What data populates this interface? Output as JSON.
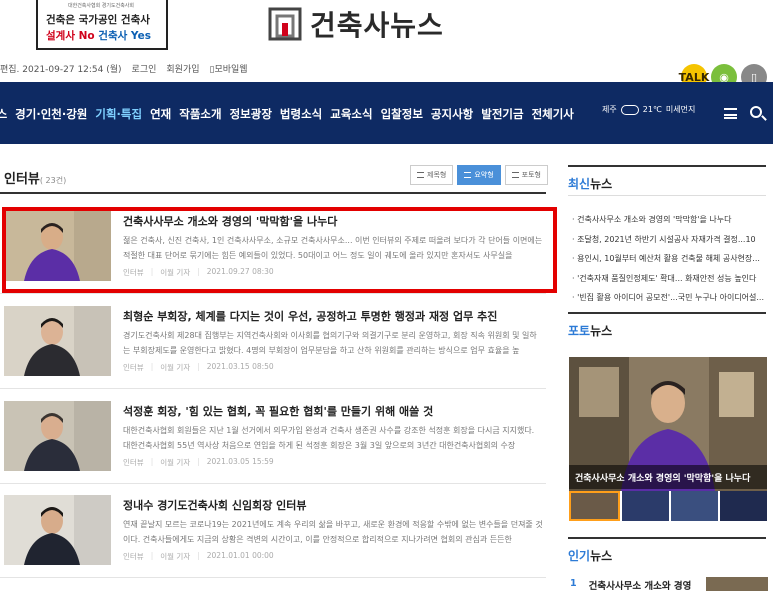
{
  "banner": {
    "small": "대한건축사협회 경기도건축사회",
    "line1": "건축은 국가공인 건축사",
    "line2_red": "설계사 No ",
    "line2_blue": "건축사 Yes"
  },
  "logo": {
    "text": "건축사뉴스"
  },
  "util": {
    "edited": "편집. 2021-09-27 12:54 (월)",
    "login": "로그인",
    "join": "회원가입",
    "mobile": "모바일웹"
  },
  "sns": [
    "카카오톡",
    "RSS",
    "설정"
  ],
  "nav": {
    "items": [
      "뉴스",
      "경기·인천·강원",
      "기획·특집",
      "연재",
      "작품소개",
      "정보광장",
      "법령소식",
      "교육소식",
      "입찰정보",
      "공지사항",
      "발전기금",
      "전체기사"
    ],
    "active_index": 2,
    "weather": {
      "city": "제주",
      "temp": "21℃",
      "dust": "미세먼지"
    }
  },
  "section": {
    "title": "인터뷰",
    "count": "( 23건)",
    "views": [
      "제목형",
      "요약형",
      "포토형"
    ],
    "active_view": 1
  },
  "articles": [
    {
      "title": "건축사사무소 개소와 경영의 '막막함'을 나누다",
      "summary": "젊은 건축사, 신진 건축사, 1인 건축사사무소, 소규모 건축사사무소... 이번 인터뷰의 주제로 떠올려 보다가 각 단어들 이면에는 적절한 대표 단어로 묶기에는 힘든 예외들이 있었다. 50대이고 어느 정도 일이 궤도에 올라 있지만 혼자서도 사무실을",
      "section": "인터뷰",
      "author": "이월 기자",
      "date": "2021.09.27 08:30"
    },
    {
      "title": "최형순 부회장, 체계를 다지는 것이 우선, 공정하고 투명한 행정과 재정 업무 추진",
      "summary": "경기도건축사회 제28대 집행부는 지역건축사회와 이사회를 협의기구와 의결기구로 분리 운영하고, 회장 직속 위원회 및 일하는 부회장제도를 운영한다고 밝혔다. 4명의 부회장이 업무분담을 하고 산하 위원회를 관리하는 방식으로 업무 효율을 높",
      "section": "인터뷰",
      "author": "이월 기자",
      "date": "2021.03.15 08:50"
    },
    {
      "title": "석정훈 회장, '힘 있는 협회, 꼭 필요한 협회'를 만들기 위해 애쓸 것",
      "summary": "대한건축사협회 회원들은 지난 1월 선거에서 의무가입 완성과 건축사 생존권 사수를 강조한 석정훈 회장을 다시금 지지했다. 대한건축사협회 55년 역사상 처음으로 연임을 하게 된 석정훈 회장은 3월 3일 앞으로의 3년간 대한건축사협회의 수장",
      "section": "인터뷰",
      "author": "이월 기자",
      "date": "2021.03.05 15:59"
    },
    {
      "title": "정내수 경기도건축사회 신임회장 인터뷰",
      "summary": "연재 끝날지 모르는 코로나19는 2021년에도 계속 우리의 삶을 바꾸고, 새로운 환경에 적응할 수밖에 없는 변수들을 던져줄 것이다. 건축사들에게도 지금의 상황은 격변의 시간이고, 이를 안정적으로 합리적으로 지나가려면 협회의 관심과 든든한",
      "section": "인터뷰",
      "author": "이월 기자",
      "date": "2021.01.01 00:00"
    }
  ],
  "sidebar": {
    "latest_title_a": "최신",
    "latest_title_b": "뉴스",
    "latest": [
      "건축사사무소 개소와 경영의 '막막함'을 나누다",
      "조달청, 2021년 하반기 시설공사 자재가격 결정...10",
      "용인시, 10월부터 예산처 활용 건축물 해체 공사현장...",
      "'건축자재 품질인정제도' 확대... 화재안전 성능 높인다",
      "'빈집 활용 아이디어 공모전'...국민 누구나 아이디어설..."
    ],
    "photo_title_a": "포토",
    "photo_title_b": "뉴스",
    "photo_caption": "건축사사무소 개소와 경영의 '막막함'을 나누다",
    "popular_title_a": "인기",
    "popular_title_b": "뉴스",
    "popular": [
      {
        "rank": "1",
        "title": "건축사사무소 개소와 경영"
      }
    ]
  },
  "colors": {
    "nav_bg": "#0e2a63",
    "accent": "#2d7bd6",
    "highlight": "#e30000"
  }
}
